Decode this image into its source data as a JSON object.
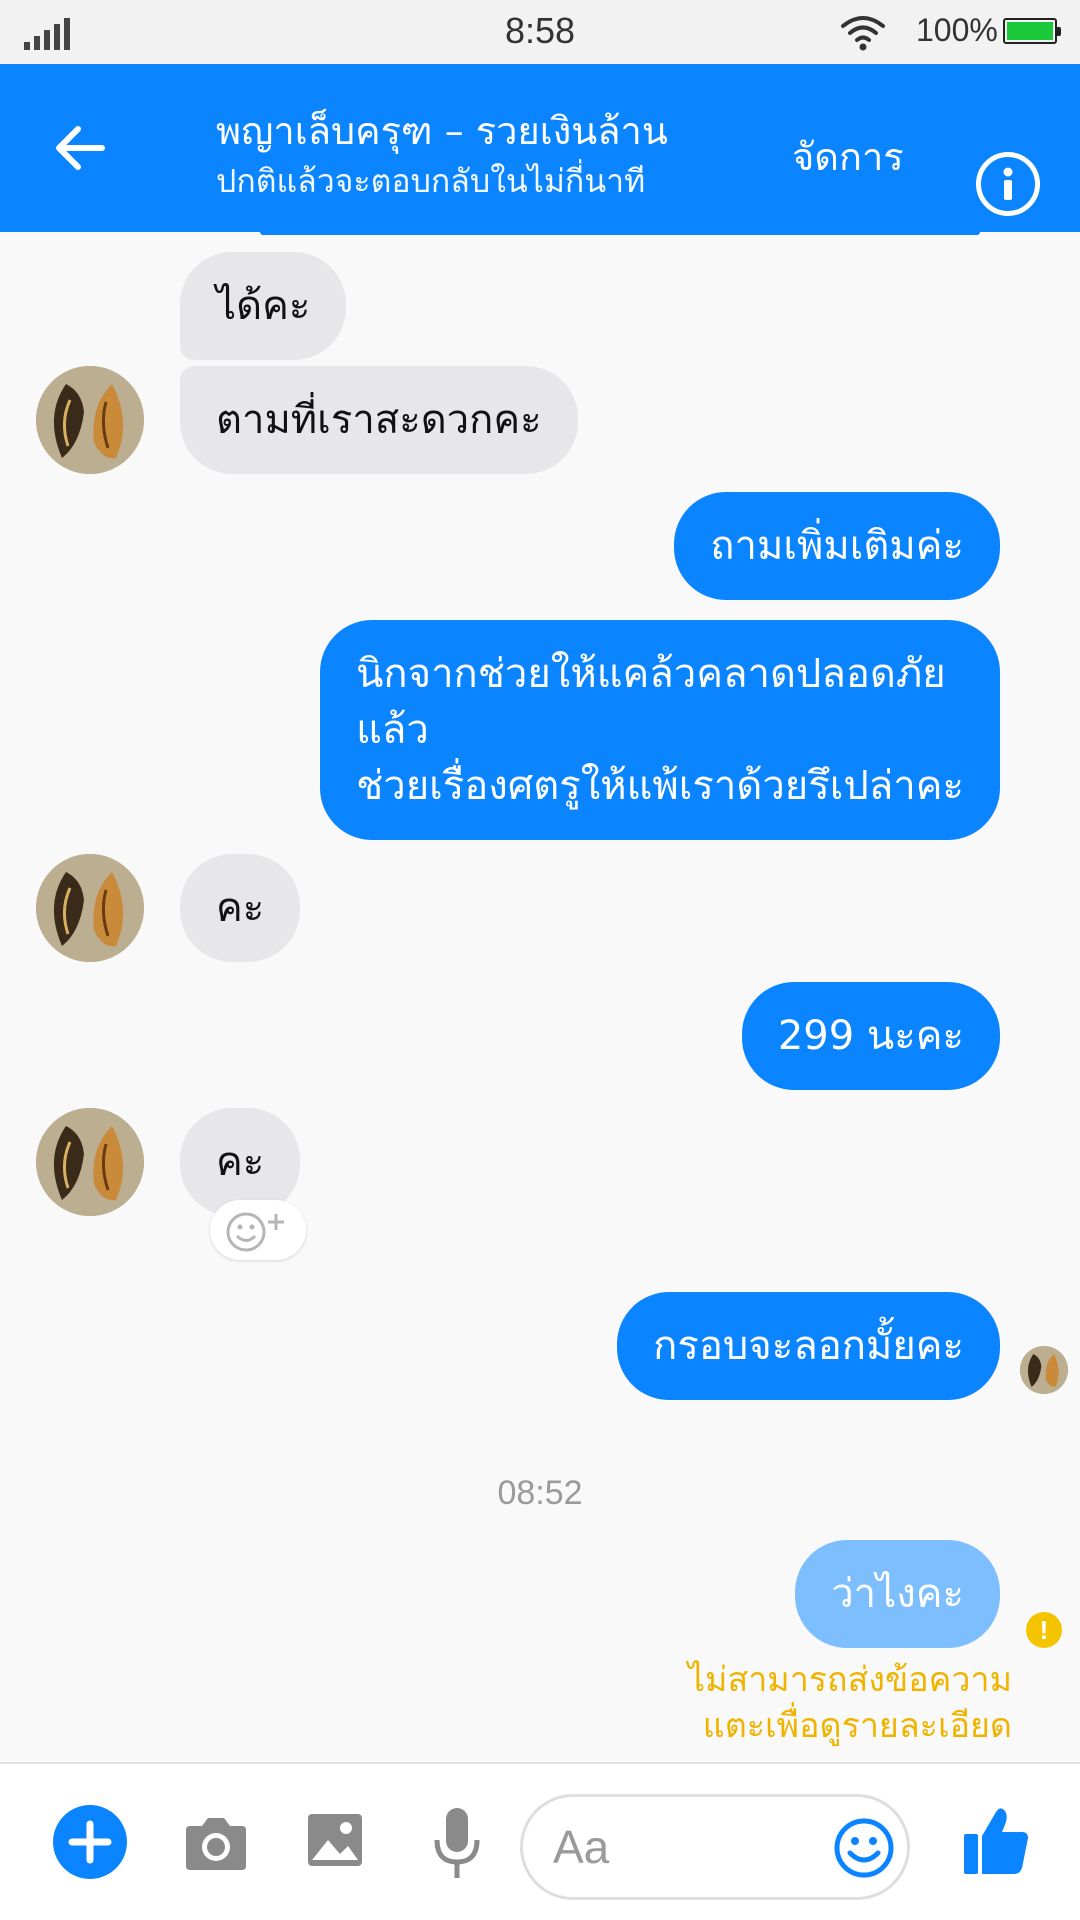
{
  "status": {
    "time": "8:58",
    "battery": "100%"
  },
  "header": {
    "title": "พญาเล็บครุฑ – รวยเงินล้าน",
    "subtitle": "ปกติแล้วจะตอบกลับในไม่กี่นาที",
    "manage_label": "จัดการ",
    "icons": {
      "back": "arrow-left-icon",
      "info": "info-icon"
    }
  },
  "messages": {
    "m1": "ได้คะ",
    "m2": "ตามที่เราสะดวกคะ",
    "m3": "ถามเพิ่มเติมค่ะ",
    "m4": {
      "line1": "นิกจากช่วยให้แคล้วคลาดปลอดภัย",
      "line2": "แล้ว",
      "line3": "ช่วยเรื่องศตรูให้แพ้เราด้วยรึเปล่าคะ"
    },
    "m5": "คะ",
    "m6": "299 นะคะ",
    "m7": "คะ",
    "m8": "กรอบจะลอกมั้ยคะ",
    "m9": "ว่าไงคะ"
  },
  "timestamp": "08:52",
  "error": {
    "line1": "ไม่สามารถส่งข้อความ",
    "line2": "แตะเพื่อดูรายละเอียด",
    "icon": "!"
  },
  "composer": {
    "placeholder": "Aa",
    "icons": [
      "plus-icon",
      "camera-icon",
      "image-icon",
      "microphone-icon",
      "emoji-icon",
      "thumbs-up-icon"
    ]
  },
  "colors": {
    "accent": "#0a84ff",
    "pending": "#7dbeff",
    "incoming": "#e7e7e9",
    "warning": "#f0b400"
  }
}
